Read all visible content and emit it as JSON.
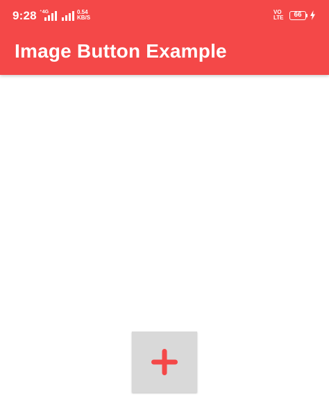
{
  "status_bar": {
    "time": "9:28",
    "network_small": "4G",
    "speed_value": "0.54",
    "speed_unit": "KB/S",
    "volte_top": "VO",
    "volte_bottom": "LTE",
    "battery_level": "66",
    "charging": true,
    "icons": [
      "arrows-icon",
      "signal-icon",
      "signal-icon",
      "volte-icon",
      "battery-icon",
      "charging-bolt-icon"
    ]
  },
  "app_bar": {
    "title": "Image Button Example",
    "color": "#F44848"
  },
  "image_button": {
    "icon": "plus-icon",
    "background": "#D9D9D9",
    "icon_color": "#F44848"
  }
}
